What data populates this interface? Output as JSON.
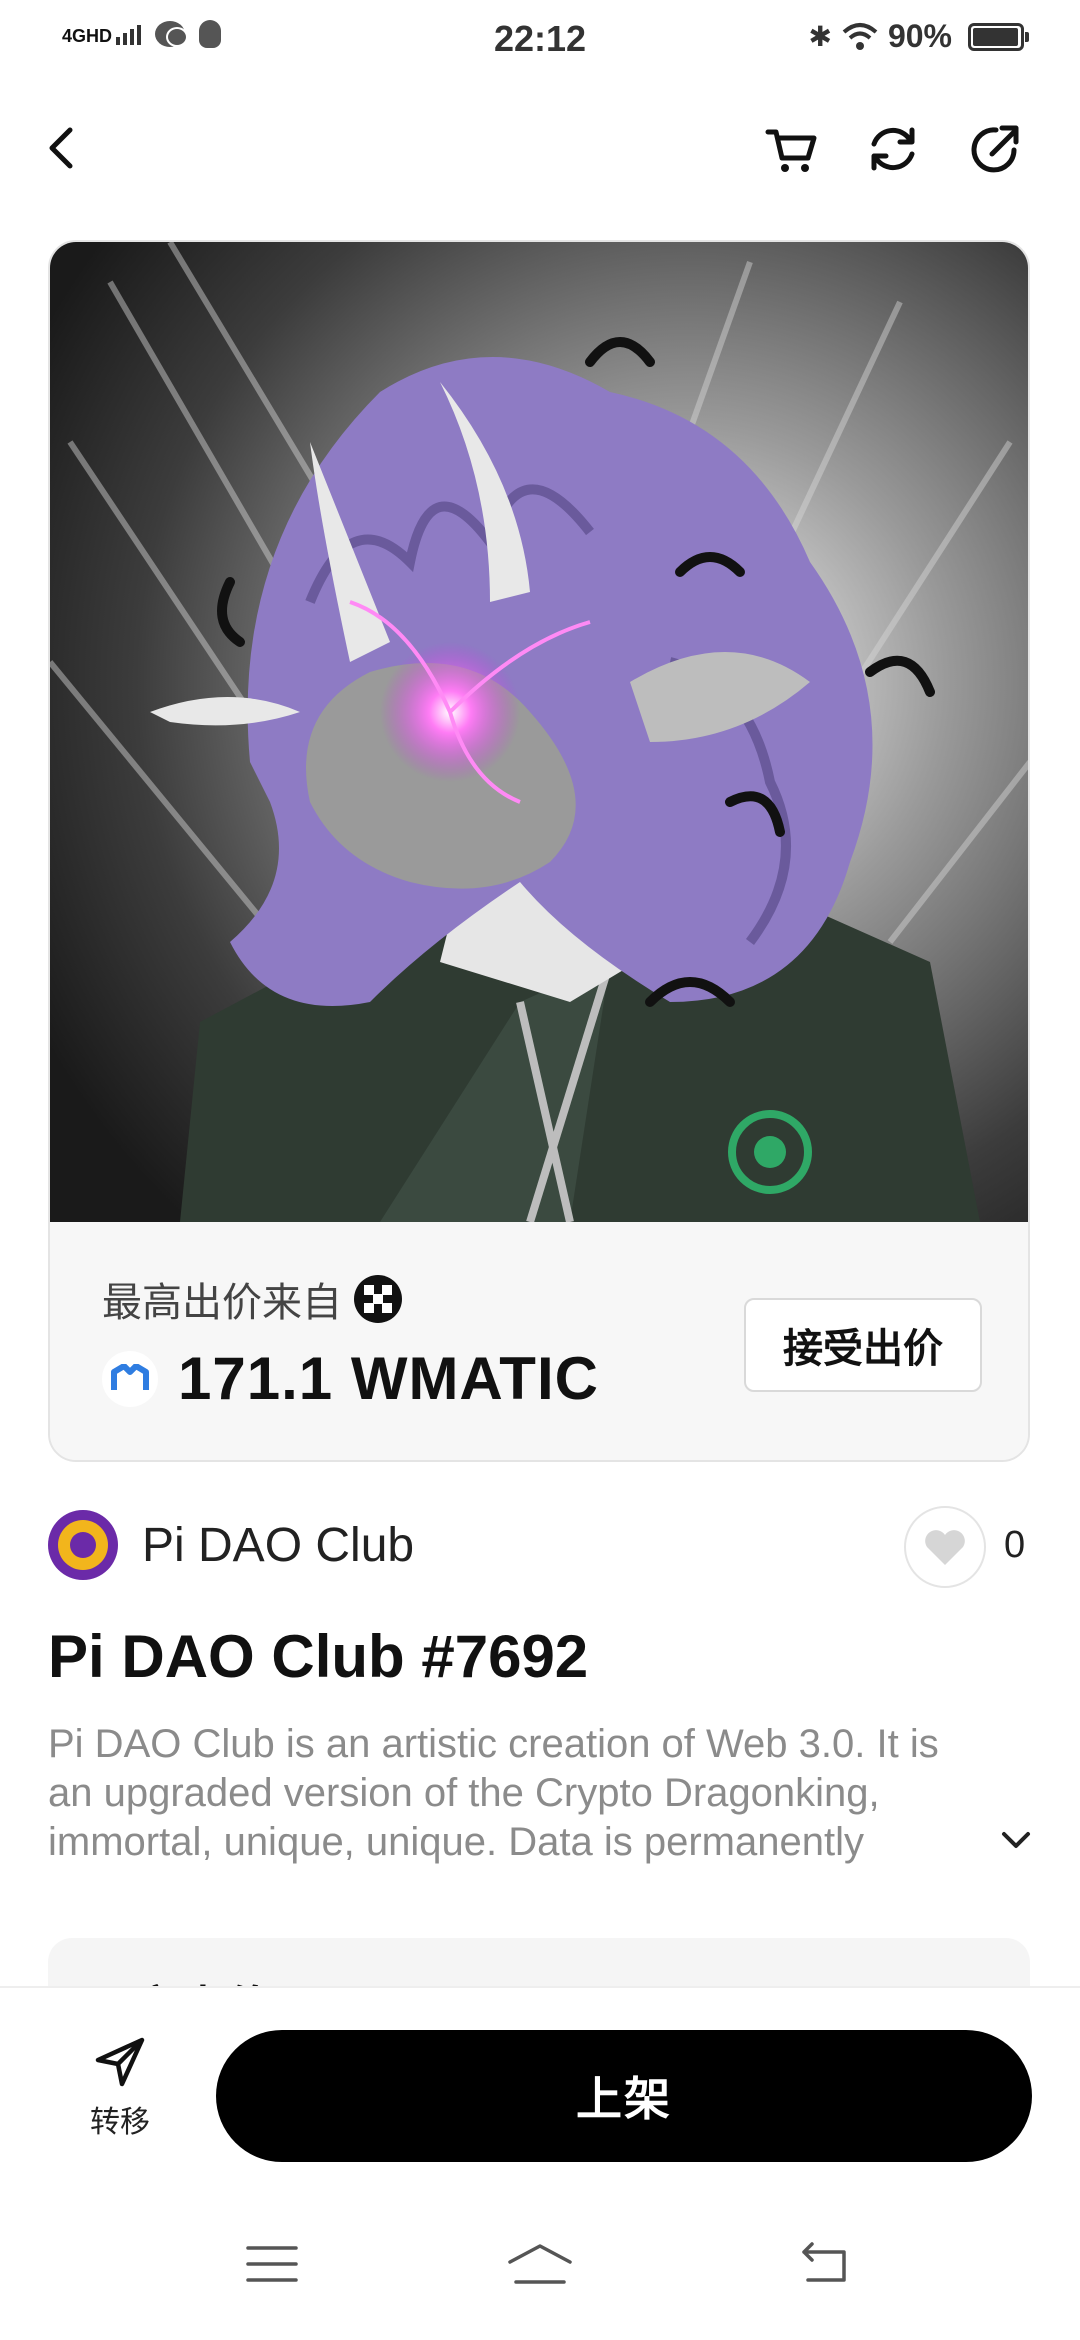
{
  "status_bar": {
    "network": "4GHD",
    "time": "22:12",
    "battery_percent": "90%"
  },
  "nav": {
    "back": "back",
    "actions": [
      "cart-icon",
      "refresh-icon",
      "share-icon"
    ]
  },
  "offer": {
    "label": "最高出价来自",
    "price": "171.1 WMATIC",
    "accept_button": "接受出价"
  },
  "collection": {
    "name": "Pi DAO Club",
    "like_count": "0"
  },
  "nft": {
    "title": "Pi DAO Club #7692",
    "description": "Pi DAO Club is an artistic creation of Web 3.0. It is an upgraded version of the Crypto Dragonking, immortal, unique, unique. Data is permanently"
  },
  "section_peek": {
    "title": "买家出价"
  },
  "bottom_bar": {
    "transfer_label": "转移",
    "list_button": "上架"
  },
  "colors": {
    "accent": "#000000",
    "background": "#ffffff",
    "card_bg": "#f7f7f7",
    "muted_text": "#8b8b8b",
    "art_purple": "#8e7bc4"
  }
}
